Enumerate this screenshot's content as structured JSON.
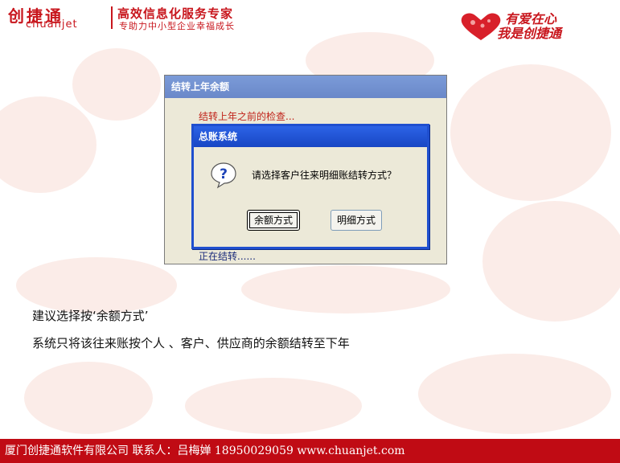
{
  "header": {
    "brand_cn": "创捷通",
    "brand_en": "chuanjet",
    "slogan": "高效信息化服务专家",
    "subslogan": "专助力中小型企业幸福成长",
    "right_line1": "有爱在心",
    "right_line2": "我是创捷通"
  },
  "window": {
    "title": "结转上年余额",
    "check_text": "结转上年之前的检查...",
    "status_text": "正在结转......"
  },
  "msgbox": {
    "title": "总账系统",
    "icon": "question-icon",
    "message": "请选择客户往来明细账结转方式？",
    "button_balance": "余额方式",
    "button_detail": "明细方式"
  },
  "body": {
    "line1": "建议选择按‘余额方式’",
    "line2": "系统只将该往来账按个人 、客户、供应商的余额结转至下年"
  },
  "footer": {
    "text": "厦门创捷通软件有限公司  联系人：吕梅婵  18950029059  www.chuanjet.com"
  },
  "colors": {
    "brand_red": "#c8161d",
    "footer_bg": "#c00b14",
    "xp_blue": "#1f4fcf"
  }
}
